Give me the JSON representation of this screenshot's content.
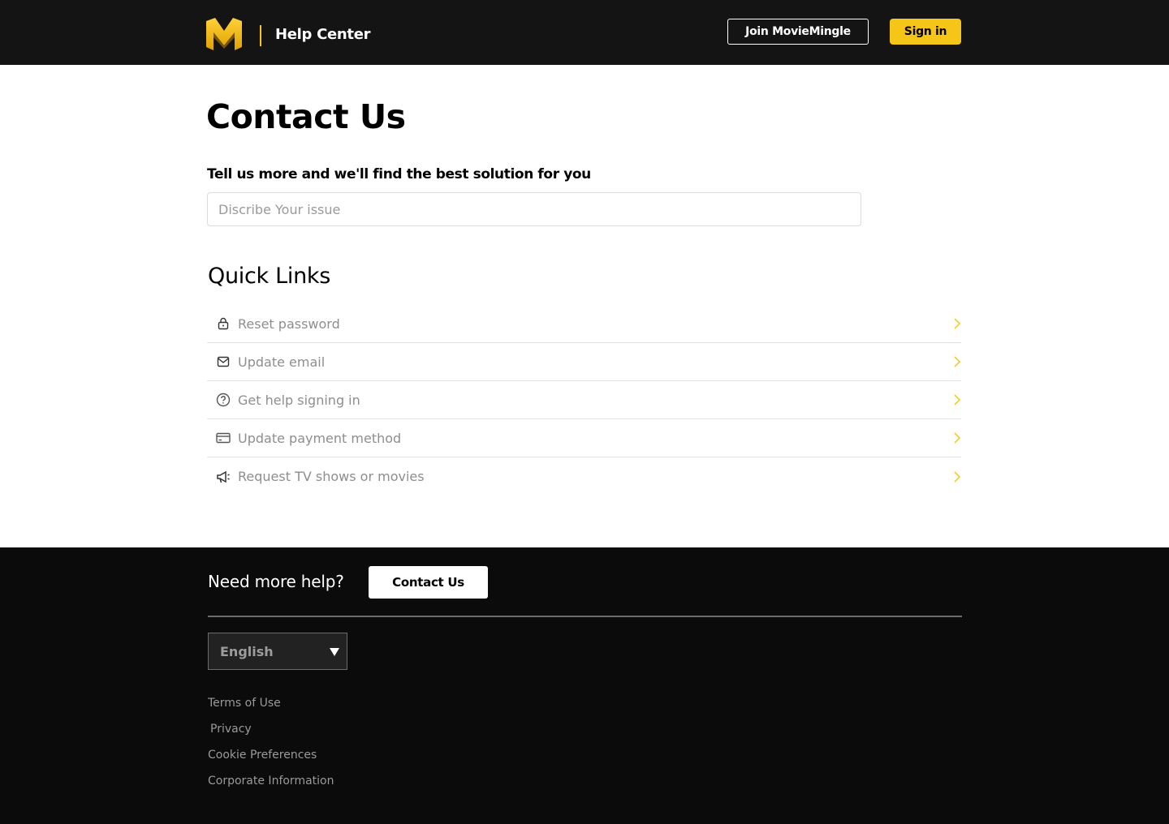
{
  "header": {
    "logo_icon": "moviemingle-m-logo",
    "title": "Help Center",
    "join_label": "Join MovieMingle",
    "signin_label": "Sign in",
    "accent_color": "#f5c518",
    "bg_color": "#141414"
  },
  "main": {
    "title": "Contact Us",
    "prompt": "Tell us more and we'll find the best solution for you",
    "issue_placeholder": "Discribe Your issue",
    "quick_links_title": "Quick Links",
    "quick_links": [
      {
        "label": "Reset password",
        "icon": "lock-icon"
      },
      {
        "label": "Update email",
        "icon": "mail-icon"
      },
      {
        "label": "Get help signing in",
        "icon": "question-circle-icon"
      },
      {
        "label": "Update payment method",
        "icon": "credit-card-icon"
      },
      {
        "label": "Request TV shows or movies",
        "icon": "megaphone-icon"
      }
    ]
  },
  "footer": {
    "need_help": "Need more help?",
    "contact_label": "Contact Us",
    "language": "English",
    "links": [
      "Terms of Use",
      "Privacy",
      "Cookie Preferences",
      "Corporate Information"
    ],
    "bg_color": "#0c0b0b"
  }
}
